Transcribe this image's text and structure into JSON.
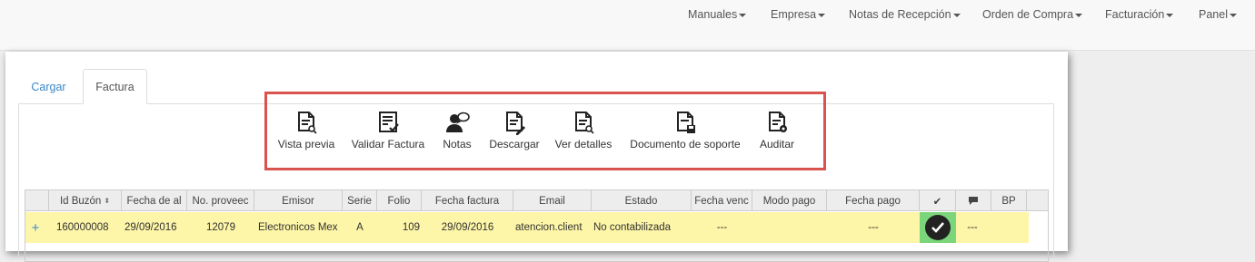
{
  "nav": {
    "items": [
      "Manuales",
      "Empresa",
      "Notas de Recepción",
      "Orden de Compra",
      "Facturación",
      "Panel"
    ]
  },
  "tabs": {
    "cargar": "Cargar",
    "factura": "Factura"
  },
  "toolbar": {
    "vista_previa": "Vista previa",
    "validar_factura": "Validar Factura",
    "notas": "Notas",
    "descargar": "Descargar",
    "ver_detalles": "Ver detalles",
    "documento_soporte": "Documento de soporte",
    "auditar": "Auditar"
  },
  "grid": {
    "columns": [
      "Id Buzón",
      "Fecha de al",
      "No. proveec",
      "Emisor",
      "Serie",
      "Folio",
      "Fecha factura",
      "Email",
      "Estado",
      "Fecha venc",
      "Modo pago",
      "Fecha pago",
      "✔",
      "",
      "BP"
    ],
    "rows": [
      {
        "expand": "+",
        "id_buzon": "160000008",
        "fecha_alta": "29/09/2016",
        "no_proveedor": "12079",
        "emisor": "Electronicos Mex",
        "serie": "A",
        "folio": "109",
        "fecha_factura": "29/09/2016",
        "email": "atencion.client",
        "estado": "No contabilizada",
        "fecha_venc": "---",
        "modo_pago": "",
        "fecha_pago": "---",
        "notes": "---",
        "bp": ""
      }
    ]
  },
  "colors": {
    "highlight": "#d9534f",
    "row": "#fdf5a7",
    "check": "#7bd67b",
    "link": "#3a87c8"
  }
}
